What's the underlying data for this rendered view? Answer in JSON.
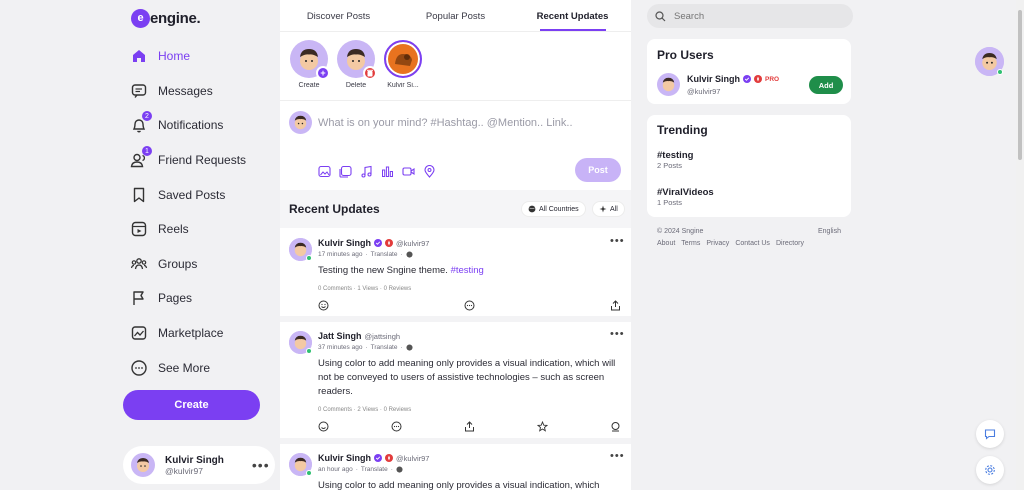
{
  "brand": {
    "mark": "e",
    "name": "engine.",
    "accent": "#7b3ff2"
  },
  "nav": {
    "items": [
      {
        "label": "Home",
        "icon": "home-icon",
        "active": true
      },
      {
        "label": "Messages",
        "icon": "messages-icon"
      },
      {
        "label": "Notifications",
        "icon": "bell-icon",
        "badge": "2"
      },
      {
        "label": "Friend Requests",
        "icon": "users-icon",
        "badge": "1"
      },
      {
        "label": "Saved Posts",
        "icon": "bookmark-icon"
      },
      {
        "label": "Reels",
        "icon": "reels-icon"
      },
      {
        "label": "Groups",
        "icon": "groups-icon"
      },
      {
        "label": "Pages",
        "icon": "flag-icon"
      },
      {
        "label": "Marketplace",
        "icon": "marketplace-icon"
      },
      {
        "label": "See More",
        "icon": "more-icon"
      }
    ],
    "create_label": "Create"
  },
  "me": {
    "name": "Kulvir Singh",
    "handle": "@kulvir97",
    "menu": "•••"
  },
  "tabs": [
    {
      "label": "Discover Posts"
    },
    {
      "label": "Popular Posts"
    },
    {
      "label": "Recent Updates",
      "active": true
    }
  ],
  "stories": [
    {
      "label": "Create"
    },
    {
      "label": "Delete"
    },
    {
      "label": "Kulvir Si..."
    }
  ],
  "composer": {
    "placeholder": "What is on your mind? #Hashtag.. @Mention.. Link..",
    "post_label": "Post"
  },
  "feed": {
    "title": "Recent Updates",
    "filter_country": "All Countries",
    "filter_all": "All"
  },
  "posts": [
    {
      "name": "Kulvir Singh",
      "handle": "@kulvir97",
      "time": "17 minutes ago",
      "translate": "Translate",
      "text": "Testing the new Sngine theme. ",
      "hashtag": "#testing",
      "stats": "0 Comments · 1 Views · 0 Reviews"
    },
    {
      "name": "Jatt Singh",
      "handle": "@jattsingh",
      "time": "37 minutes ago",
      "translate": "Translate",
      "text": "Using color to add meaning only provides a visual indication, which will not be conveyed to users of assistive technologies – such as screen readers.",
      "stats": "0 Comments · 2 Views · 0 Reviews"
    },
    {
      "name": "Kulvir Singh",
      "handle": "@kulvir97",
      "time": "an hour ago",
      "translate": "Translate",
      "text": "Using color to add meaning only provides a visual indication, which"
    }
  ],
  "search": {
    "placeholder": "Search"
  },
  "pro_users": {
    "title": "Pro Users",
    "user": {
      "name": "Kulvir Singh",
      "handle": "@kulvir97",
      "badge": "PRO"
    },
    "add_label": "Add"
  },
  "trending": {
    "title": "Trending",
    "items": [
      {
        "tag": "#testing",
        "count": "2 Posts"
      },
      {
        "tag": "#ViralVideos",
        "count": "1 Posts"
      }
    ]
  },
  "footer": {
    "copyright": "© 2024 Sngine",
    "language": "English",
    "links": [
      "About",
      "Terms",
      "Privacy",
      "Contact Us",
      "Directory"
    ]
  }
}
